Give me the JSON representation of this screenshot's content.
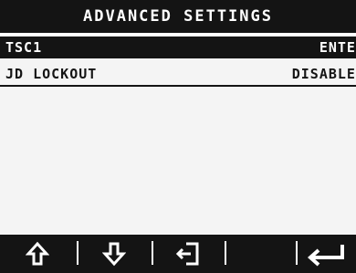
{
  "header": {
    "title": "ADVANCED SETTINGS"
  },
  "rows": [
    {
      "label": "TSC1",
      "value": "ENTER"
    },
    {
      "label": "JD LOCKOUT",
      "value": "DISABLED"
    }
  ],
  "softkeys": [
    {
      "icon": "arrow-up-icon"
    },
    {
      "icon": "arrow-down-icon"
    },
    {
      "icon": "exit-icon"
    },
    {
      "icon": ""
    },
    {
      "icon": "enter-icon"
    }
  ],
  "colors": {
    "dark": "#141414",
    "light": "#f4f4f4"
  }
}
